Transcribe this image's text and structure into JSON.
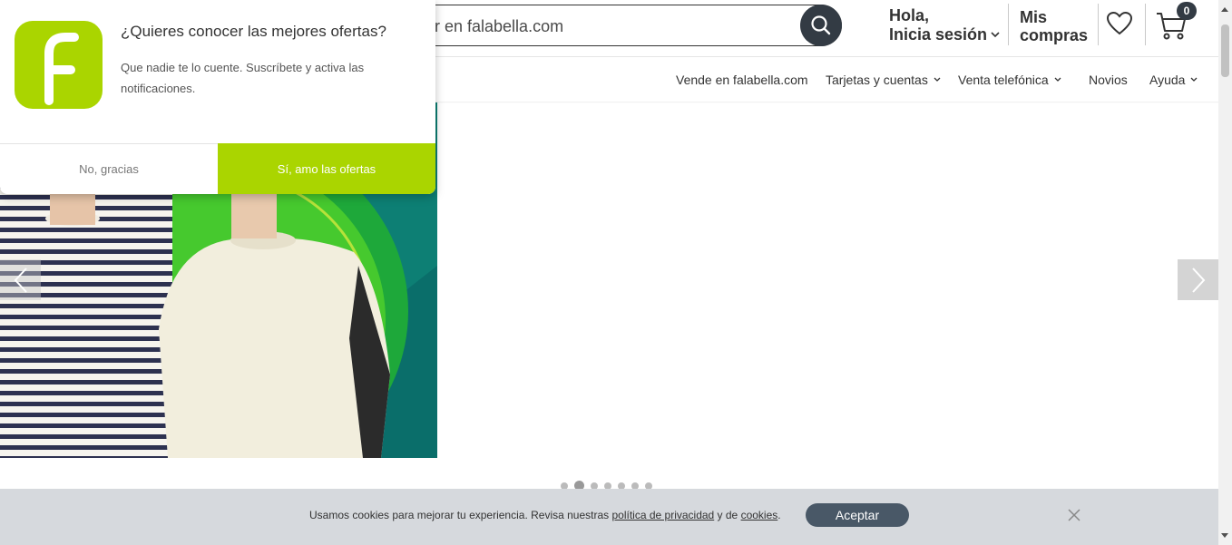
{
  "header": {
    "search_placeholder": "r en falabella.com",
    "greeting_line1": "Hola,",
    "greeting_line2": "Inicia sesión",
    "orders_line1": "Mis",
    "orders_line2": "compras",
    "cart_count": "0"
  },
  "subnav": [
    {
      "label": "Vende en falabella.com",
      "dropdown": false
    },
    {
      "label": "Tarjetas y cuentas",
      "dropdown": true
    },
    {
      "label": "Venta telefónica",
      "dropdown": true
    },
    {
      "label": "Novios",
      "dropdown": false
    },
    {
      "label": "Ayuda",
      "dropdown": true
    }
  ],
  "popup": {
    "title": "¿Quieres conocer las mejores ofertas?",
    "text": "Que nadie te lo cuente. Suscríbete y activa las notificaciones.",
    "decline_label": "No, gracias",
    "accept_label": "Sí, amo las ofertas"
  },
  "slider": {
    "dot_count": 7,
    "active_index": 1
  },
  "cookies": {
    "text_before": "Usamos cookies para mejorar tu experiencia. Revisa nuestras ",
    "privacy_link": "política de privacidad",
    "text_middle": " y de ",
    "cookies_link": "cookies",
    "text_end": ".",
    "accept_label": "Aceptar"
  },
  "colors": {
    "brand_green": "#aad500",
    "dark": "#333b44",
    "cookie_bg": "#d6d9dd",
    "accept_bg": "#495867"
  }
}
